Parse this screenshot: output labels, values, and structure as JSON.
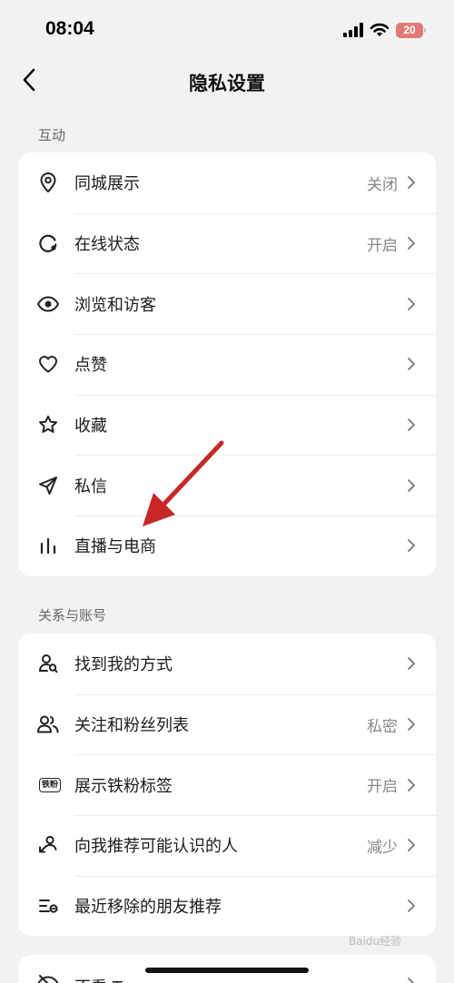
{
  "status_bar": {
    "time": "08:04",
    "battery": "20"
  },
  "nav": {
    "title": "隐私设置"
  },
  "sections": [
    {
      "label": "互动",
      "items": [
        {
          "label": "同城展示",
          "value": "关闭",
          "icon": "location-pin-icon"
        },
        {
          "label": "在线状态",
          "value": "开启",
          "icon": "online-status-icon"
        },
        {
          "label": "浏览和访客",
          "value": "",
          "icon": "eye-icon"
        },
        {
          "label": "点赞",
          "value": "",
          "icon": "heart-icon"
        },
        {
          "label": "收藏",
          "value": "",
          "icon": "star-icon"
        },
        {
          "label": "私信",
          "value": "",
          "icon": "paper-plane-icon"
        },
        {
          "label": "直播与电商",
          "value": "",
          "icon": "bars-icon"
        }
      ]
    },
    {
      "label": "关系与账号",
      "items": [
        {
          "label": "找到我的方式",
          "value": "",
          "icon": "find-user-icon"
        },
        {
          "label": "关注和粉丝列表",
          "value": "私密",
          "icon": "users-icon"
        },
        {
          "label": "展示铁粉标签",
          "value": "开启",
          "icon": "fan-badge-icon"
        },
        {
          "label": "向我推荐可能认识的人",
          "value": "减少",
          "icon": "recommend-user-icon"
        },
        {
          "label": "最近移除的朋友推荐",
          "value": "",
          "icon": "removed-list-icon"
        }
      ]
    }
  ],
  "partial_row": {
    "label": "不看 Ta",
    "icon": "eye-off-icon"
  },
  "fan_badge_text": "铁粉",
  "watermark": "Baidu经验",
  "annotation": {
    "arrow_color": "#c62828"
  }
}
